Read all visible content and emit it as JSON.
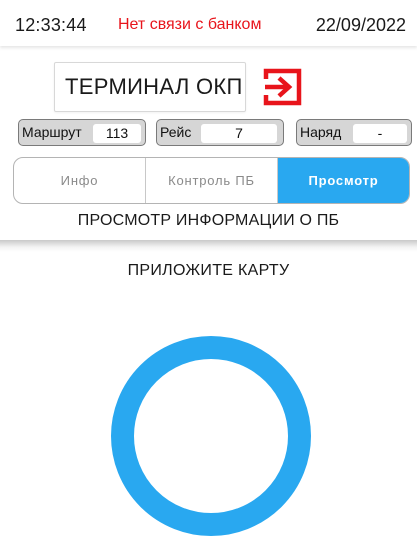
{
  "status": {
    "time": "12:33:44",
    "bank_status": "Нет связи с банком",
    "date": "22/09/2022"
  },
  "header": {
    "title": "ТЕРМИНАЛ ОКП",
    "logout_icon": "logout-icon"
  },
  "params": {
    "route": {
      "label": "Маршрут",
      "value": "113"
    },
    "trip": {
      "label": "Рейс",
      "value": "7"
    },
    "order": {
      "label": "Наряд",
      "value": "-"
    }
  },
  "tabs": [
    {
      "label": "Инфо",
      "active": false
    },
    {
      "label": "Контроль ПБ",
      "active": false
    },
    {
      "label": "Просмотр",
      "active": true
    }
  ],
  "section_title": "ПРОСМОТР ИНФОРМАЦИИ О ПБ",
  "prompt": "ПРИЛОЖИТЕ КАРТУ",
  "colors": {
    "accent": "#29a8f0",
    "error": "#e8141b"
  }
}
